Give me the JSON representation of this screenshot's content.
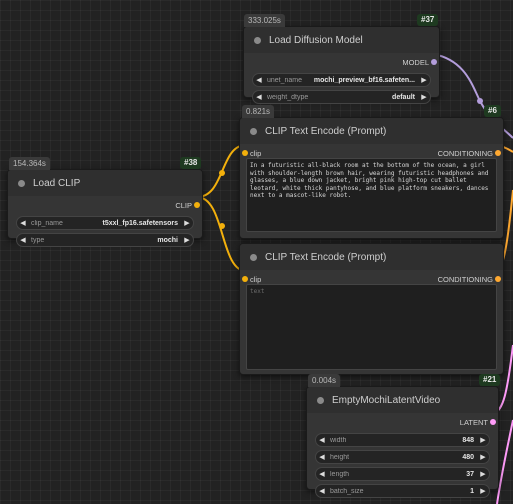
{
  "nodes": {
    "load_diffusion": {
      "timing": "333.025s",
      "badge": "#37",
      "title": "Load Diffusion Model",
      "output": "MODEL",
      "widgets": [
        {
          "name": "unet_name",
          "value": "mochi_preview_bf16.safeten..."
        },
        {
          "name": "weight_dtype",
          "value": "default"
        }
      ]
    },
    "clip_encode_1": {
      "timing": "0.821s",
      "badge": "#6",
      "title": "CLIP Text Encode (Prompt)",
      "input": "clip",
      "output": "CONDITIONING",
      "text": "In a futuristic all-black room at the bottom of the ocean, a girl with shoulder-length brown hair, wearing futuristic headphones and glasses, a blue down jacket, bright pink high-top cut ballet leotard, white thick pantyhose, and blue platform sneakers, dances next to a mascot-like robot."
    },
    "load_clip": {
      "timing": "154.364s",
      "badge": "#38",
      "title": "Load CLIP",
      "output": "CLIP",
      "widgets": [
        {
          "name": "clip_name",
          "value": "t5xxl_fp16.safetensors"
        },
        {
          "name": "type",
          "value": "mochi"
        }
      ]
    },
    "clip_encode_2": {
      "title": "CLIP Text Encode (Prompt)",
      "input": "clip",
      "output": "CONDITIONING",
      "placeholder": "text"
    },
    "empty_latent": {
      "timing": "0.004s",
      "badge": "#21",
      "title": "EmptyMochiLatentVideo",
      "output": "LATENT",
      "widgets": [
        {
          "name": "width",
          "value": "848"
        },
        {
          "name": "height",
          "value": "480"
        },
        {
          "name": "length",
          "value": "37"
        },
        {
          "name": "batch_size",
          "value": "1"
        }
      ]
    }
  },
  "colors": {
    "model": "#b39ddb",
    "clip": "#f3b00c",
    "conditioning": "#ffa931",
    "latent": "#ff9cf9"
  },
  "icons": {
    "left_arrow": "◀",
    "right_arrow": "▶"
  }
}
